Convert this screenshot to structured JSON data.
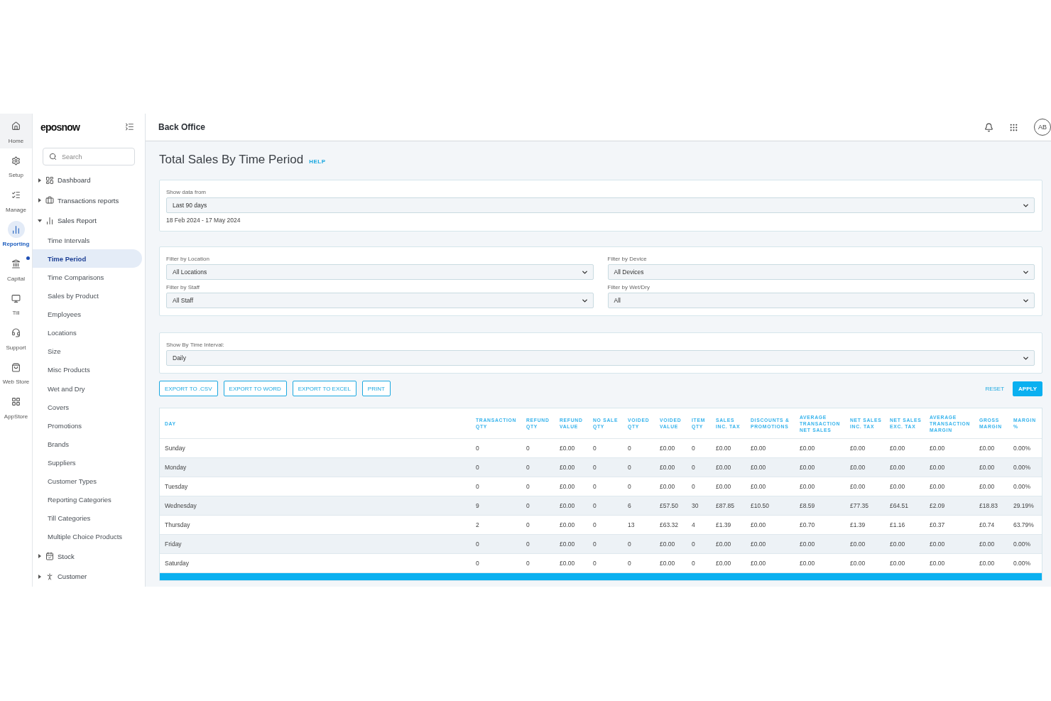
{
  "rail": [
    {
      "label": "Home",
      "selected": false,
      "highlighted": true,
      "notification": false
    },
    {
      "label": "Setup",
      "selected": false,
      "highlighted": false,
      "notification": false
    },
    {
      "label": "Manage",
      "selected": false,
      "highlighted": false,
      "notification": false
    },
    {
      "label": "Reporting",
      "selected": true,
      "highlighted": false,
      "notification": false
    },
    {
      "label": "Capital",
      "selected": false,
      "highlighted": false,
      "notification": true
    },
    {
      "label": "Till",
      "selected": false,
      "highlighted": false,
      "notification": false
    },
    {
      "label": "Support",
      "selected": false,
      "highlighted": false,
      "notification": false
    },
    {
      "label": "Web Store",
      "selected": false,
      "highlighted": false,
      "notification": false
    },
    {
      "label": "AppStore",
      "selected": false,
      "highlighted": false,
      "notification": false
    }
  ],
  "sidebar": {
    "logo": "eposnow",
    "search": {
      "placeholder": "Search"
    },
    "items": [
      {
        "label": "Dashboard",
        "expanded": false
      },
      {
        "label": "Transactions reports",
        "expanded": false
      },
      {
        "label": "Sales Report",
        "expanded": true,
        "children": [
          {
            "label": "Time Intervals",
            "selected": false
          },
          {
            "label": "Time Period",
            "selected": true
          },
          {
            "label": "Time Comparisons",
            "selected": false
          },
          {
            "label": "Sales by Product",
            "selected": false
          },
          {
            "label": "Employees",
            "selected": false
          },
          {
            "label": "Locations",
            "selected": false
          },
          {
            "label": "Size",
            "selected": false
          },
          {
            "label": "Misc Products",
            "selected": false
          },
          {
            "label": "Wet and Dry",
            "selected": false
          },
          {
            "label": "Covers",
            "selected": false
          },
          {
            "label": "Promotions",
            "selected": false
          },
          {
            "label": "Brands",
            "selected": false
          },
          {
            "label": "Suppliers",
            "selected": false
          },
          {
            "label": "Customer Types",
            "selected": false
          },
          {
            "label": "Reporting Categories",
            "selected": false
          },
          {
            "label": "Till Categories",
            "selected": false
          },
          {
            "label": "Multiple Choice Products",
            "selected": false
          }
        ]
      },
      {
        "label": "Stock",
        "expanded": false
      },
      {
        "label": "Customer",
        "expanded": false
      }
    ]
  },
  "header": {
    "title": "Back Office",
    "avatar": "AB"
  },
  "page": {
    "title": "Total Sales By Time Period",
    "help": "HELP"
  },
  "date_card": {
    "label": "Show data from",
    "value": "Last 90 days",
    "range": "18 Feb 2024 - 17 May 2024"
  },
  "filters": [
    {
      "label": "Filter by Location",
      "value": "All Locations"
    },
    {
      "label": "Filter by Device",
      "value": "All Devices"
    },
    {
      "label": "Filter by Staff",
      "value": "All Staff"
    },
    {
      "label": "Filter by Wet/Dry",
      "value": "All"
    }
  ],
  "interval": {
    "label": "Show By Time Interval:",
    "value": "Daily"
  },
  "actions": [
    {
      "label": "EXPORT TO .CSV",
      "kind": "outline"
    },
    {
      "label": "EXPORT TO WORD",
      "kind": "outline"
    },
    {
      "label": "EXPORT TO EXCEL",
      "kind": "outline"
    },
    {
      "label": "PRINT",
      "kind": "outline"
    },
    {
      "label": "RESET",
      "kind": "link"
    },
    {
      "label": "APPLY",
      "kind": "primary"
    }
  ],
  "table": {
    "columns": [
      "DAY",
      "TRANSACTION QTY",
      "REFUND QTY",
      "REFUND VALUE",
      "NO SALE QTY",
      "VOIDED QTY",
      "VOIDED VALUE",
      "ITEM QTY",
      "SALES INC. TAX",
      "DISCOUNTS & PROMOTIONS",
      "AVERAGE TRANSACTION NET SALES",
      "NET SALES INC. TAX",
      "NET SALES EXC. TAX",
      "AVERAGE TRANSACTION MARGIN",
      "GROSS MARGIN",
      "MARGIN %"
    ],
    "rows": [
      [
        "Sunday",
        "0",
        "0",
        "£0.00",
        "0",
        "0",
        "£0.00",
        "0",
        "£0.00",
        "£0.00",
        "£0.00",
        "£0.00",
        "£0.00",
        "£0.00",
        "£0.00",
        "0.00%"
      ],
      [
        "Monday",
        "0",
        "0",
        "£0.00",
        "0",
        "0",
        "£0.00",
        "0",
        "£0.00",
        "£0.00",
        "£0.00",
        "£0.00",
        "£0.00",
        "£0.00",
        "£0.00",
        "0.00%"
      ],
      [
        "Tuesday",
        "0",
        "0",
        "£0.00",
        "0",
        "0",
        "£0.00",
        "0",
        "£0.00",
        "£0.00",
        "£0.00",
        "£0.00",
        "£0.00",
        "£0.00",
        "£0.00",
        "0.00%"
      ],
      [
        "Wednesday",
        "9",
        "0",
        "£0.00",
        "0",
        "6",
        "£57.50",
        "30",
        "£87.85",
        "£10.50",
        "£8.59",
        "£77.35",
        "£64.51",
        "£2.09",
        "£18.83",
        "29.19%"
      ],
      [
        "Thursday",
        "2",
        "0",
        "£0.00",
        "0",
        "13",
        "£63.32",
        "4",
        "£1.39",
        "£0.00",
        "£0.70",
        "£1.39",
        "£1.16",
        "£0.37",
        "£0.74",
        "63.79%"
      ],
      [
        "Friday",
        "0",
        "0",
        "£0.00",
        "0",
        "0",
        "£0.00",
        "0",
        "£0.00",
        "£0.00",
        "£0.00",
        "£0.00",
        "£0.00",
        "£0.00",
        "£0.00",
        "0.00%"
      ],
      [
        "Saturday",
        "0",
        "0",
        "£0.00",
        "0",
        "0",
        "£0.00",
        "0",
        "£0.00",
        "£0.00",
        "£0.00",
        "£0.00",
        "£0.00",
        "£0.00",
        "£0.00",
        "0.00%"
      ]
    ]
  }
}
